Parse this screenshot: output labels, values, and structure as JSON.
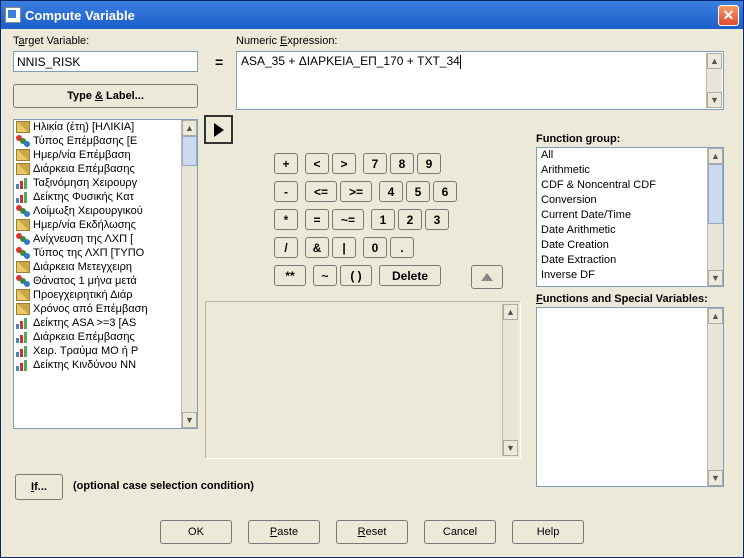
{
  "title": "Compute Variable",
  "labels": {
    "target_pre": "T",
    "target_u": "a",
    "target_post": "rget Variable:",
    "numexp_pre": "Numeric ",
    "numexp_u": "E",
    "numexp_post": "xpression:",
    "typelabel_pre": "Type ",
    "typelabel_amp": "&",
    "typelabel_post": " Label...",
    "fungroup_pre": "Function ",
    "fungroup_u": "g",
    "fungroup_post": "roup:",
    "funspec_pre": "",
    "funspec_u": "F",
    "funspec_post": "unctions and Special Variables:",
    "if_pre": "",
    "if_u": "I",
    "if_post": "f...",
    "ifdesc": "(optional case selection condition)",
    "eq": "="
  },
  "target_value": "NNIS_RISK",
  "expression": "ASA_35 + ΔΙΑΡΚΕΙΑ_ΕΠ_170 + TXT_34",
  "varlist": [
    {
      "icon": "ruler",
      "label": "Ηλικία (έτη) [ΗΛΙΚΙΑ]"
    },
    {
      "icon": "circles",
      "label": "Τύπος Επέμβασης [E"
    },
    {
      "icon": "ruler",
      "label": "Ημερ/νία Επέμβαση"
    },
    {
      "icon": "ruler",
      "label": "Διάρκεια Επέμβασης"
    },
    {
      "icon": "bars",
      "label": "Ταξινόμηση Χειρουργ"
    },
    {
      "icon": "bars",
      "label": "Δείκτης Φυσικής Κατ"
    },
    {
      "icon": "circles",
      "label": "Λοίμωξη Χειρουργικού"
    },
    {
      "icon": "ruler",
      "label": "Ημερ/νία Εκδήλωσης"
    },
    {
      "icon": "circles",
      "label": "Ανίχνευση της ΛΧΠ ["
    },
    {
      "icon": "circles",
      "label": "Τύπος της ΛΧΠ [ΤΥΠΟ"
    },
    {
      "icon": "ruler",
      "label": "Διάρκεια Μετεγχειρη"
    },
    {
      "icon": "circles",
      "label": "Θάνατος 1 μήνα μετά"
    },
    {
      "icon": "ruler",
      "label": "Προεγχειρητική Διάρ"
    },
    {
      "icon": "ruler",
      "label": "Χρόνος από Επέμβαση"
    },
    {
      "icon": "bars",
      "label": "Δείκτης ASA >=3 [AS"
    },
    {
      "icon": "bars",
      "label": "Διάρκεια Επέμβασης"
    },
    {
      "icon": "bars",
      "label": "Χειρ. Τραύμα ΜΟ ή Ρ"
    },
    {
      "icon": "bars",
      "label": "Δείκτης Κινδύνου NN"
    }
  ],
  "keypad": [
    [
      [
        "+"
      ],
      [
        "<",
        ">"
      ],
      [
        "7",
        "8",
        "9"
      ]
    ],
    [
      [
        "-"
      ],
      [
        "<=",
        ">="
      ],
      [
        "4",
        "5",
        "6"
      ]
    ],
    [
      [
        "*"
      ],
      [
        "=",
        "~="
      ],
      [
        "1",
        "2",
        "3"
      ]
    ],
    [
      [
        "/"
      ],
      [
        "&",
        "|"
      ],
      [
        "0",
        "."
      ]
    ],
    [
      [
        "**"
      ],
      [
        "~",
        "( )"
      ],
      [
        "Delete"
      ]
    ]
  ],
  "fgroups": [
    "All",
    "Arithmetic",
    "CDF & Noncentral CDF",
    "Conversion",
    "Current Date/Time",
    "Date Arithmetic",
    "Date Creation",
    "Date Extraction",
    "Inverse DF"
  ],
  "buttons": {
    "ok": "OK",
    "paste_u": "P",
    "paste_post": "aste",
    "reset_u": "R",
    "reset_post": "eset",
    "cancel": "Cancel",
    "help": "Help"
  }
}
